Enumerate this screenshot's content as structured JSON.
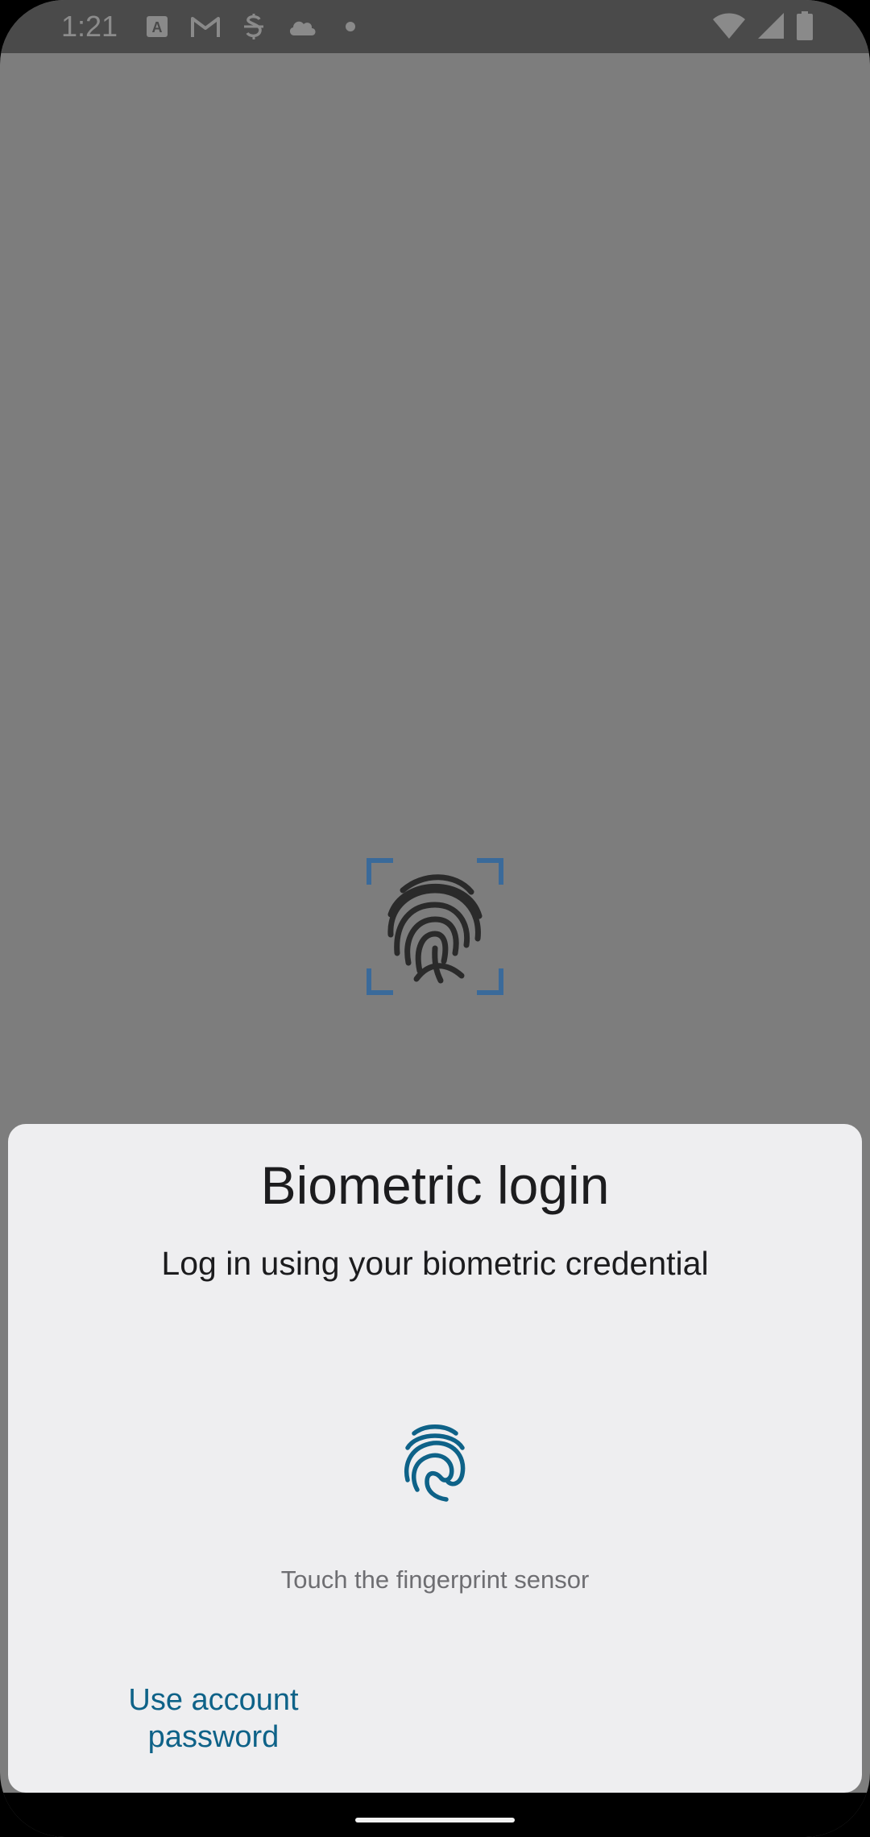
{
  "status_bar": {
    "time": "1:21",
    "left_icons": [
      "font-a-icon",
      "gmail-icon",
      "strikethrough-s-icon",
      "cloud-icon",
      "dot-icon"
    ],
    "right_icons": [
      "wifi-icon",
      "signal-icon",
      "battery-icon"
    ]
  },
  "dialog": {
    "title": "Biometric login",
    "subtitle": "Log in using your biometric credential",
    "hint": "Touch the fingerprint sensor",
    "alt_button_line1": "Use account",
    "alt_button_line2": "password"
  },
  "colors": {
    "scrim": "#7d7d7d",
    "sheet": "#eeeef0",
    "accent": "#0e6288",
    "background_fp_frame": "#3a6a9a"
  }
}
